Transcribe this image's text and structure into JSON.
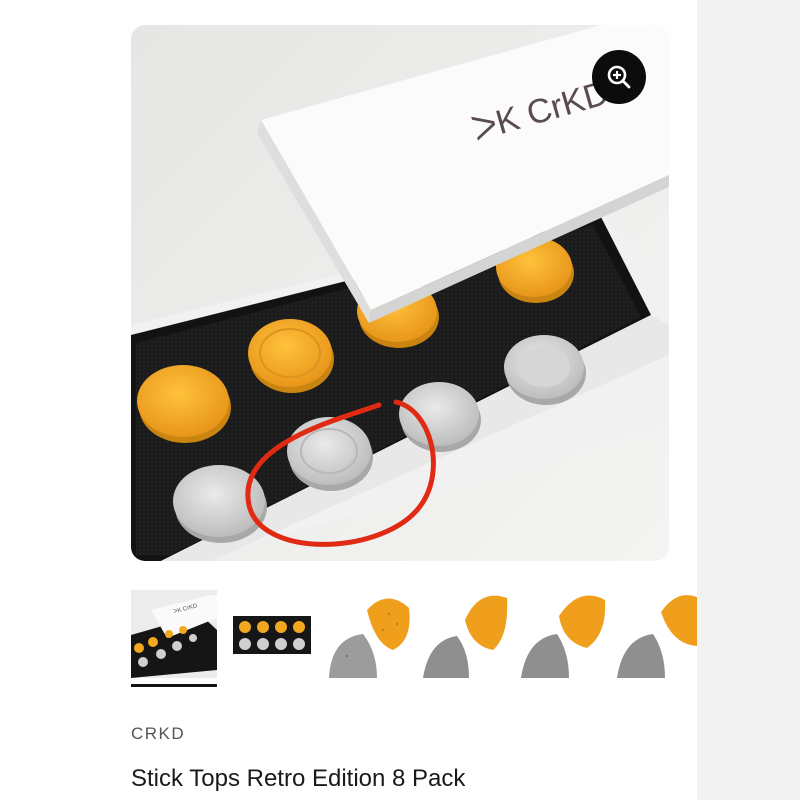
{
  "product": {
    "brand": "CRKD",
    "title": "Stick Tops Retro Edition 8 Pack"
  },
  "gallery": {
    "box_logo": "ᐳK CrKD",
    "zoom_icon": "zoom-in-icon",
    "thumbnail_count": 6,
    "selected_thumbnail": 1,
    "thumbnails": [
      {
        "name": "open-box"
      },
      {
        "name": "tray-top-view"
      },
      {
        "name": "textured-domed-tops"
      },
      {
        "name": "concave-tops"
      },
      {
        "name": "convex-tops"
      },
      {
        "name": "ringed-tops"
      }
    ]
  },
  "colors": {
    "orange": "#f2a81e",
    "gray_cap": "#cfcfcf",
    "foam": "#1e1e1e",
    "annotation": "#e02a14"
  }
}
